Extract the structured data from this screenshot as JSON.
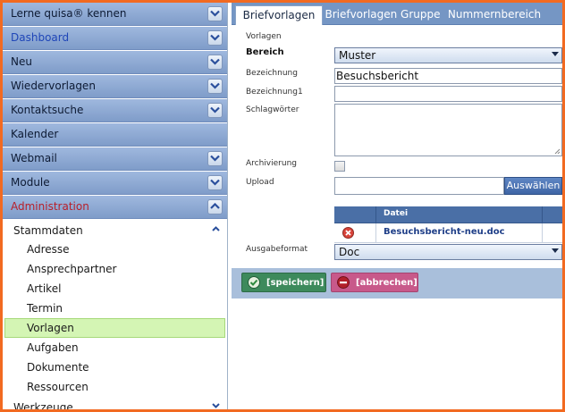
{
  "sidebar": {
    "sections": [
      {
        "label": "Lerne quisa® kennen",
        "style": "normal",
        "chevron": "down"
      },
      {
        "label": "Dashboard",
        "style": "blue",
        "chevron": "down"
      },
      {
        "label": "Neu",
        "style": "normal",
        "chevron": "down"
      },
      {
        "label": "Wiedervorlagen",
        "style": "normal",
        "chevron": "down"
      },
      {
        "label": "Kontaktsuche",
        "style": "normal",
        "chevron": "down"
      },
      {
        "label": "Kalender",
        "style": "normal",
        "chevron": "none"
      },
      {
        "label": "Webmail",
        "style": "normal",
        "chevron": "down"
      },
      {
        "label": "Module",
        "style": "normal",
        "chevron": "down"
      },
      {
        "label": "Administration",
        "style": "red",
        "chevron": "up"
      }
    ],
    "stammdaten": {
      "label": "Stammdaten",
      "items": [
        "Adresse",
        "Ansprechpartner",
        "Artikel",
        "Termin",
        "Vorlagen",
        "Aufgaben",
        "Dokumente",
        "Ressourcen"
      ],
      "active": "Vorlagen"
    },
    "werkzeuge": {
      "label": "Werkzeuge"
    }
  },
  "tabs": [
    {
      "label": "Briefvorlagen",
      "active": true
    },
    {
      "label": "Briefvorlagen Gruppe",
      "active": false
    },
    {
      "label": "Nummernbereich",
      "active": false
    }
  ],
  "form": {
    "heading": "Vorlagen",
    "bereich": {
      "label": "Bereich",
      "value": "Muster"
    },
    "bezeichnung": {
      "label": "Bezeichnung",
      "value": "Besuchsbericht"
    },
    "bezeichnung1": {
      "label": "Bezeichnung1",
      "value": ""
    },
    "schlagwoerter": {
      "label": "Schlagwörter",
      "value": ""
    },
    "archivierung": {
      "label": "Archivierung",
      "checked": false
    },
    "upload": {
      "label": "Upload",
      "value": "",
      "button": "Auswählen"
    },
    "files_table": {
      "header": "Datei",
      "rows": [
        {
          "file": "Besuchsbericht-neu.doc"
        }
      ]
    },
    "ausgabeformat": {
      "label": "Ausgabeformat",
      "value": "Doc"
    }
  },
  "footer": {
    "save_label": "[speichern]",
    "cancel_label": "[abbrechen]"
  },
  "colors": {
    "frame": "#f26a21",
    "header_blue": "#7596c4",
    "active_item": "#d4f5b4",
    "save": "#3d8a5c",
    "cancel": "#c8598a"
  }
}
